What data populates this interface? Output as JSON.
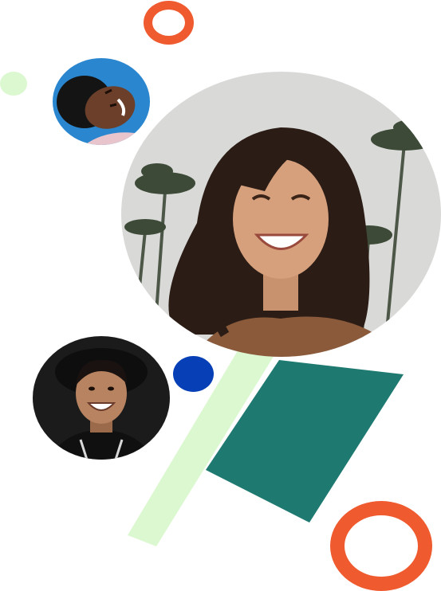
{
  "colors": {
    "ring": "#ef5a2f",
    "light_green": "#dcf8d0",
    "teal": "#1e7a71",
    "blue": "#063fb6",
    "sky_main": "#d8d8d8",
    "sky_small": "#2a86cf",
    "dark_bg": "#1b1b1b"
  },
  "icons": {
    "photo_main": "photo-woman-palm-trees",
    "photo_small": "photo-woman-blue-background",
    "photo_man": "photo-man-dark-background"
  }
}
